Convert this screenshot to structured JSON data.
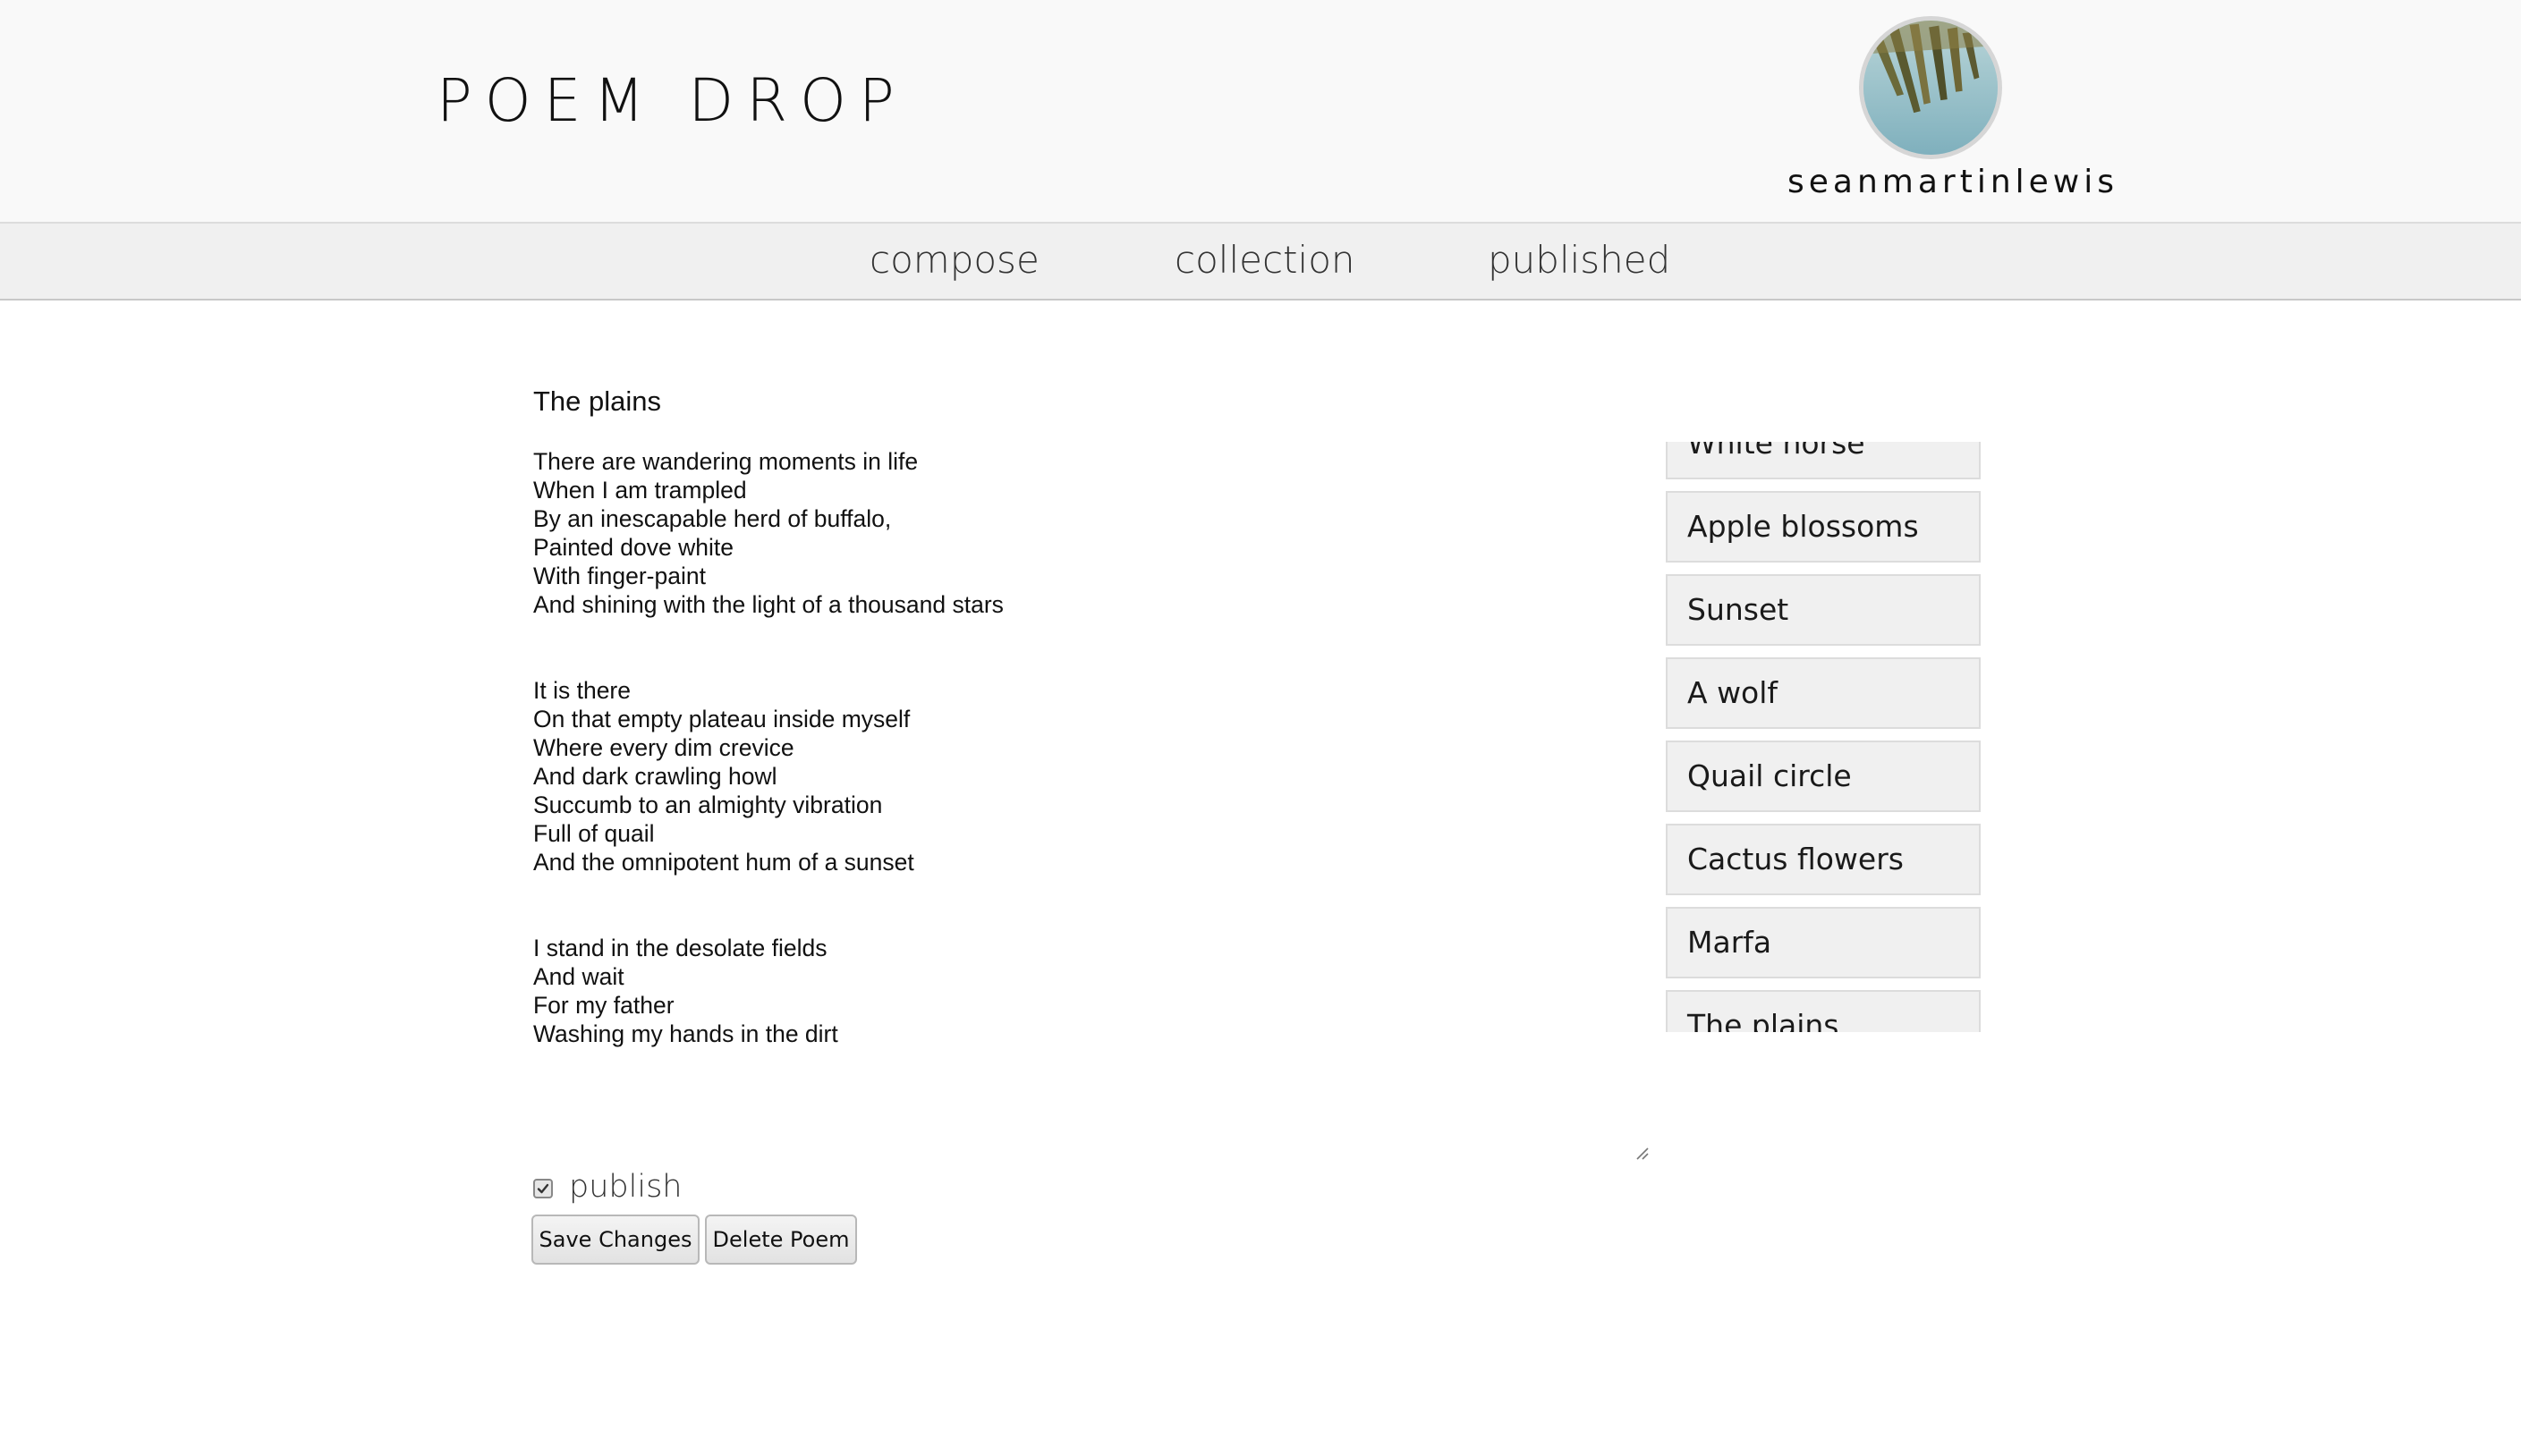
{
  "header": {
    "site_title": "POEM DROP",
    "username": "seanmartinlewis",
    "avatar_icon": "profile-photo-icon"
  },
  "nav": {
    "items": [
      {
        "label": "compose"
      },
      {
        "label": "collection"
      },
      {
        "label": "published"
      }
    ]
  },
  "editor": {
    "title": "The plains",
    "body": "There are wandering moments in life\nWhen I am trampled\nBy an inescapable herd of buffalo,\nPainted dove white\nWith finger-paint\nAnd shining with the light of a thousand stars\n\n\nIt is there\nOn that empty plateau inside myself\nWhere every dim crevice\nAnd dark crawling howl\nSuccumb to an almighty vibration\nFull of quail\nAnd the omnipotent hum of a sunset\n\n\nI stand in the desolate fields\nAnd wait\nFor my father\nWashing my hands in the dirt",
    "publish_label": "publish",
    "publish_checked": true,
    "save_label": "Save Changes",
    "delete_label": "Delete Poem"
  },
  "poem_list": {
    "items": [
      {
        "label": "White horse"
      },
      {
        "label": "Apple blossoms"
      },
      {
        "label": "Sunset"
      },
      {
        "label": "A wolf"
      },
      {
        "label": "Quail circle"
      },
      {
        "label": "Cactus flowers"
      },
      {
        "label": "Marfa"
      },
      {
        "label": "The plains"
      }
    ]
  }
}
